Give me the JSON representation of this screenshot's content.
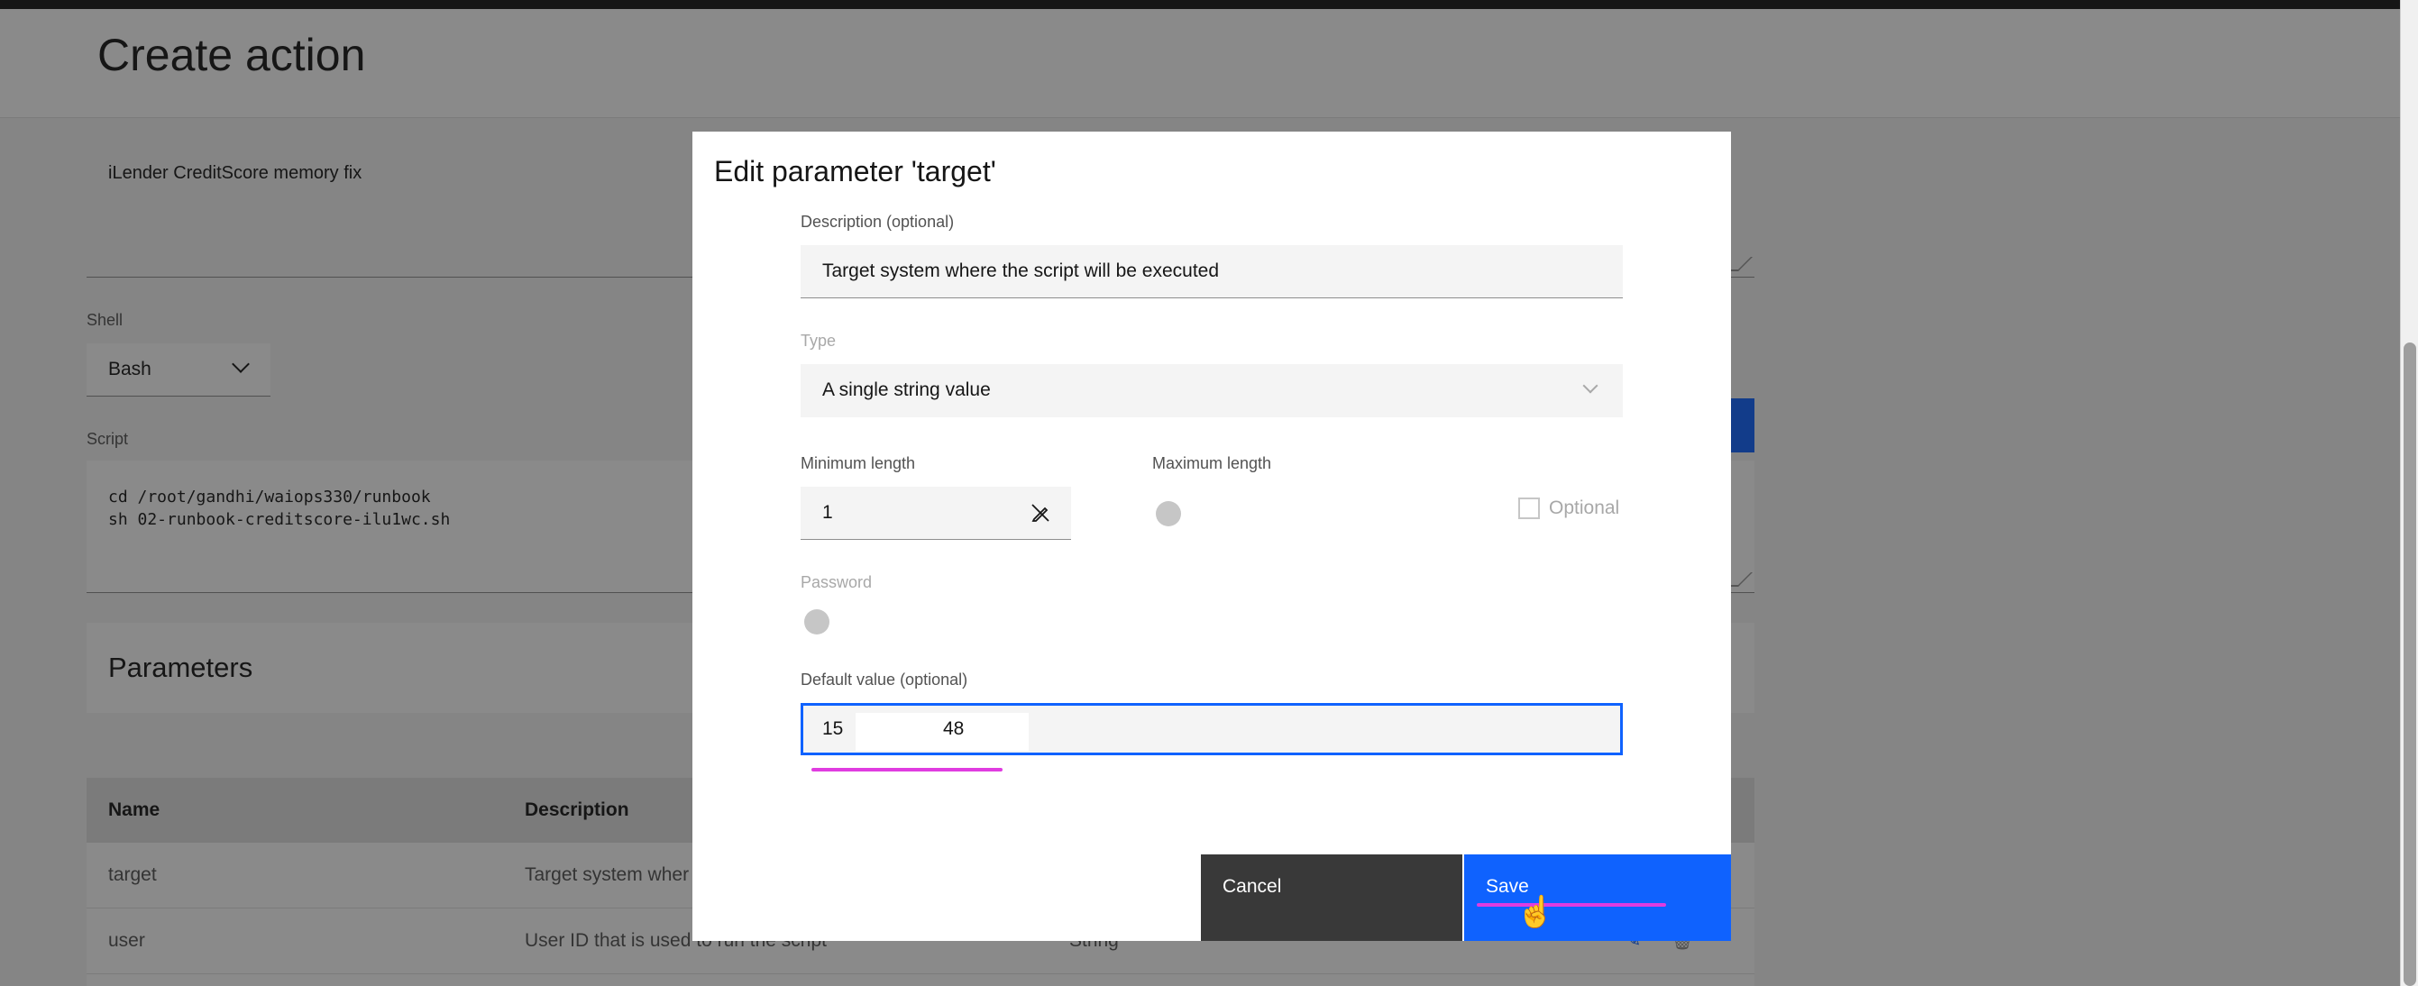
{
  "page": {
    "title": "Create action",
    "name_value": "iLender CreditScore memory fix",
    "shell_label": "Shell",
    "shell_value": "Bash",
    "script_label": "Script",
    "script_lines": [
      "cd /root/gandhi/waiops330/runbook",
      "sh 02-runbook-creditscore-ilu1wc.sh"
    ]
  },
  "parameters": {
    "title": "Parameters",
    "columns": [
      "Name",
      "Description"
    ],
    "rows": [
      {
        "name": "target",
        "description": "Target system wher"
      },
      {
        "name": "user",
        "description": "User ID that is used to run the script",
        "type": "String"
      }
    ]
  },
  "modal": {
    "title": "Edit parameter 'target'",
    "description_label": "Description (optional)",
    "description_value": "Target system where the script will be executed",
    "type_label": "Type",
    "type_value": "A single string value",
    "min_length_label": "Minimum length",
    "min_length_value": "1",
    "max_length_label": "Maximum length",
    "optional_label": "Optional",
    "password_label": "Password",
    "default_label": "Default value (optional)",
    "default_value_prefix": "15",
    "default_value_suffix": "48",
    "cancel_label": "Cancel",
    "save_label": "Save"
  },
  "colors": {
    "primary": "#0f62fe",
    "secondary_button": "#393939",
    "overlay": "rgba(22,22,22,0.5)",
    "annotation": "#e03ce0"
  },
  "icons": [
    "chevron-down-icon",
    "pen-crossed-icon",
    "edit-icon",
    "trash-icon",
    "hand-cursor-icon"
  ]
}
